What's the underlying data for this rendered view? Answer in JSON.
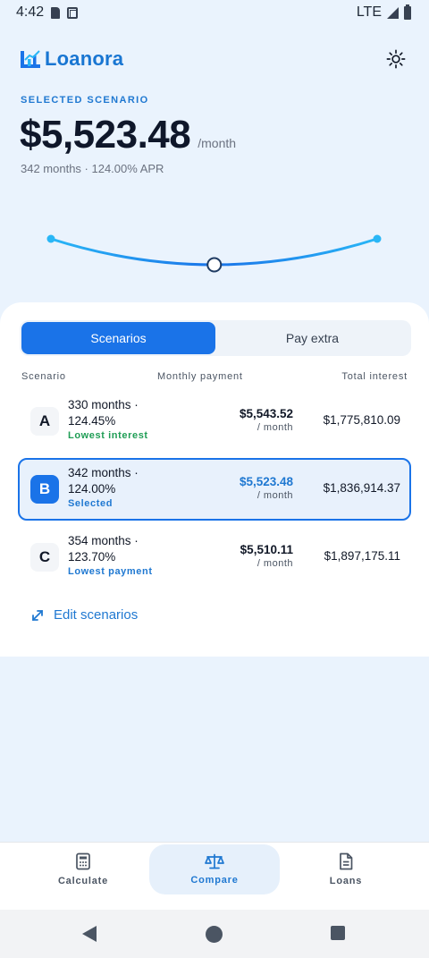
{
  "status_bar": {
    "time": "4:42",
    "network": "LTE"
  },
  "app": {
    "name": "Loanora"
  },
  "hero": {
    "label": "SELECTED SCENARIO",
    "amount": "$5,523.48",
    "per": "/month",
    "subtitle": "342 months · 124.00% APR",
    "slider_position": 0.5
  },
  "tabs": [
    {
      "label": "Scenarios",
      "active": true
    },
    {
      "label": "Pay extra",
      "active": false
    }
  ],
  "table": {
    "headers": {
      "scenario": "Scenario",
      "monthly": "Monthly payment",
      "interest": "Total interest"
    },
    "rows": [
      {
        "letter": "A",
        "line1": "330 months ·",
        "line2": "124.45%",
        "tag": "Lowest interest",
        "monthly": "$5,543.52",
        "unit": "/ month",
        "interest": "$1,775,810.09",
        "selected": false
      },
      {
        "letter": "B",
        "line1": "342 months ·",
        "line2": "124.00%",
        "tag": "Selected",
        "monthly": "$5,523.48",
        "unit": "/ month",
        "interest": "$1,836,914.37",
        "selected": true
      },
      {
        "letter": "C",
        "line1": "354 months ·",
        "line2": "123.70%",
        "tag": "Lowest payment",
        "monthly": "$5,510.11",
        "unit": "/ month",
        "interest": "$1,897,175.11",
        "selected": false
      }
    ]
  },
  "edit_link": {
    "label": "Edit scenarios"
  },
  "nav": {
    "items": [
      {
        "label": "Calculate",
        "icon": "calculator-icon",
        "active": false
      },
      {
        "label": "Compare",
        "icon": "scale-icon",
        "active": true
      },
      {
        "label": "Loans",
        "icon": "document-icon",
        "active": false
      }
    ]
  },
  "colors": {
    "accent": "#1a73e8",
    "green": "#1f9d55",
    "background": "#eaf3fd"
  }
}
